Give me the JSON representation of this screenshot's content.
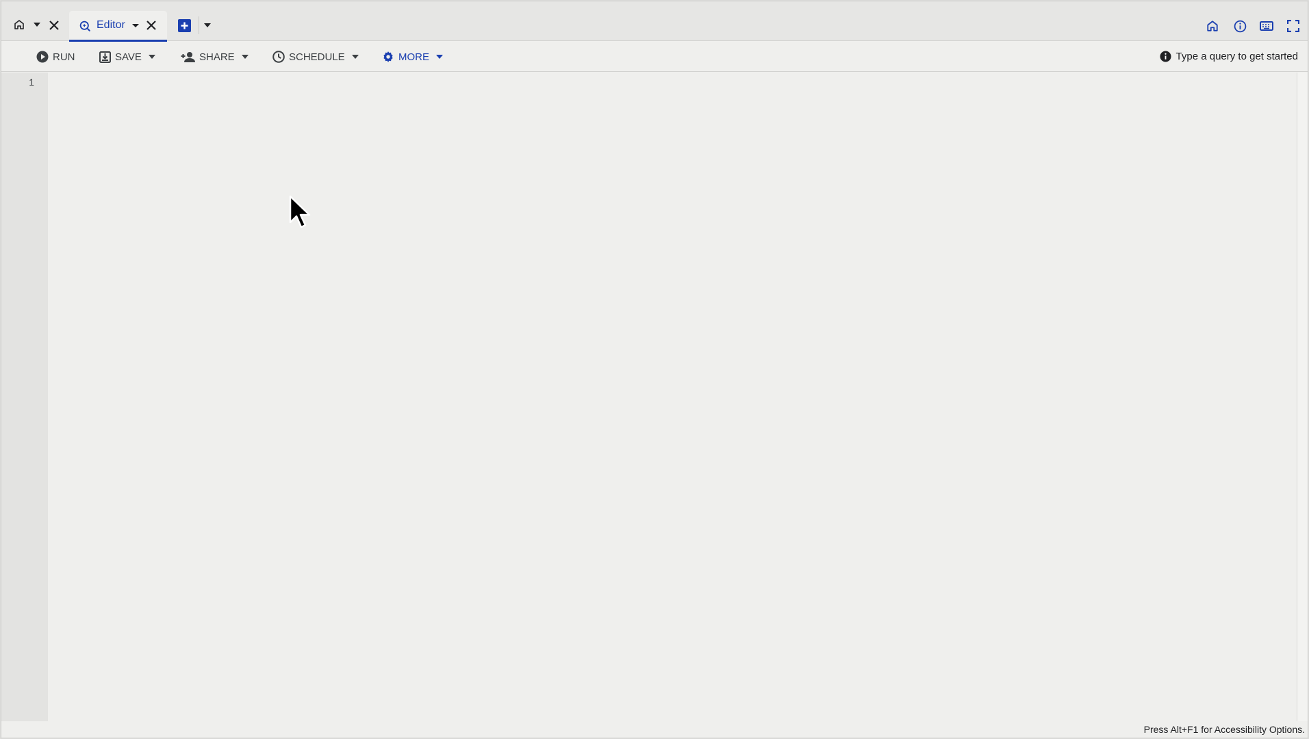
{
  "tabs": {
    "active_tab_label": "Editor"
  },
  "toolbar": {
    "run_label": "RUN",
    "save_label": "SAVE",
    "share_label": "SHARE",
    "schedule_label": "SCHEDULE",
    "more_label": "MORE",
    "hint_text": "Type a query to get started"
  },
  "editor": {
    "line_numbers": [
      "1"
    ],
    "content": ""
  },
  "status": {
    "accessibility_text": "Press Alt+F1 for Accessibility Options."
  },
  "icons": {
    "home_tab": "home-icon",
    "editor_tab": "search-query-icon",
    "new_tab": "plus-square-icon",
    "right": [
      "home-icon",
      "info-icon",
      "keyboard-icon",
      "fullscreen-icon"
    ],
    "run": "play-circle-icon",
    "save": "save-icon",
    "share": "add-person-icon",
    "schedule": "clock-icon",
    "more": "gear-icon",
    "hint": "info-filled-icon"
  },
  "colors": {
    "accent": "#1a3fb0",
    "background": "#efefed",
    "tabbar": "#e6e6e4",
    "gutter": "#e3e3e1",
    "text": "#202124"
  }
}
